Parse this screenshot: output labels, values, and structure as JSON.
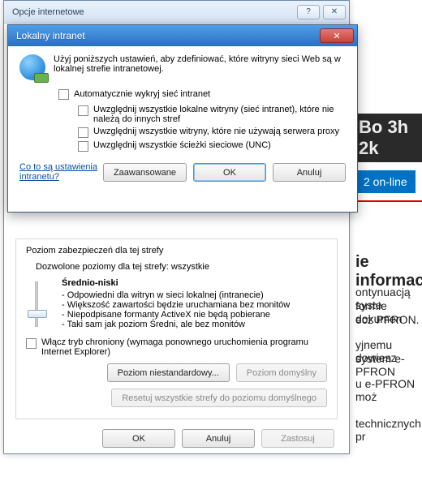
{
  "background": {
    "online_badge": "2 on-line",
    "darkbox": "Bo 3h 2k",
    "heading": "ie informac",
    "p1": "ontynuacją syste",
    "p2": "formie dokumen",
    "p3": "ecz PFRON.",
    "p4": "yjnemu dowiesz",
    "p5": "system e-PFRON",
    "p6": "u e-PFRON moż",
    "p7": "technicznych pr"
  },
  "outer": {
    "title": "Opcje internetowe",
    "help_glyph": "?",
    "close_glyph": "✕",
    "group_legend": "Poziom zabezpieczeń dla tej strefy",
    "allowed": "Dozwolone poziomy dla tej strefy: wszystkie",
    "level_name": "Średnio-niski",
    "level_pts": [
      "- Odpowiedni dla witryn w sieci lokalnej (intranecie)",
      "- Większość zawartości będzie uruchamiana bez monitów",
      "- Niepodpisane formanty ActiveX nie będą pobierane",
      "- Taki sam jak poziom Średni, ale bez monitów"
    ],
    "protected_label": "Włącz tryb chroniony (wymaga ponownego uruchomienia programu Internet Explorer)",
    "btn_custom": "Poziom niestandardowy...",
    "btn_default": "Poziom domyślny",
    "btn_reset": "Resetuj wszystkie strefy do poziomu domyślnego",
    "btn_ok": "OK",
    "btn_cancel": "Anuluj",
    "btn_apply": "Zastosuj"
  },
  "inner": {
    "title": "Lokalny intranet",
    "close_glyph": "✕",
    "intro": "Użyj poniższych ustawień, aby zdefiniować, które witryny sieci Web są w lokalnej strefie intranetowej.",
    "auto_label": "Automatycznie wykryj sieć intranet",
    "sub1": "Uwzględnij wszystkie lokalne witryny (sieć intranet), które nie należą do innych stref",
    "sub2": "Uwzględnij wszystkie witryny, które nie używają serwera proxy",
    "sub3": "Uwzględnij wszystkie ścieżki sieciowe (UNC)",
    "link": "Co to są ustawienia intranetu?",
    "btn_adv": "Zaawansowane",
    "btn_ok": "OK",
    "btn_cancel": "Anuluj"
  }
}
